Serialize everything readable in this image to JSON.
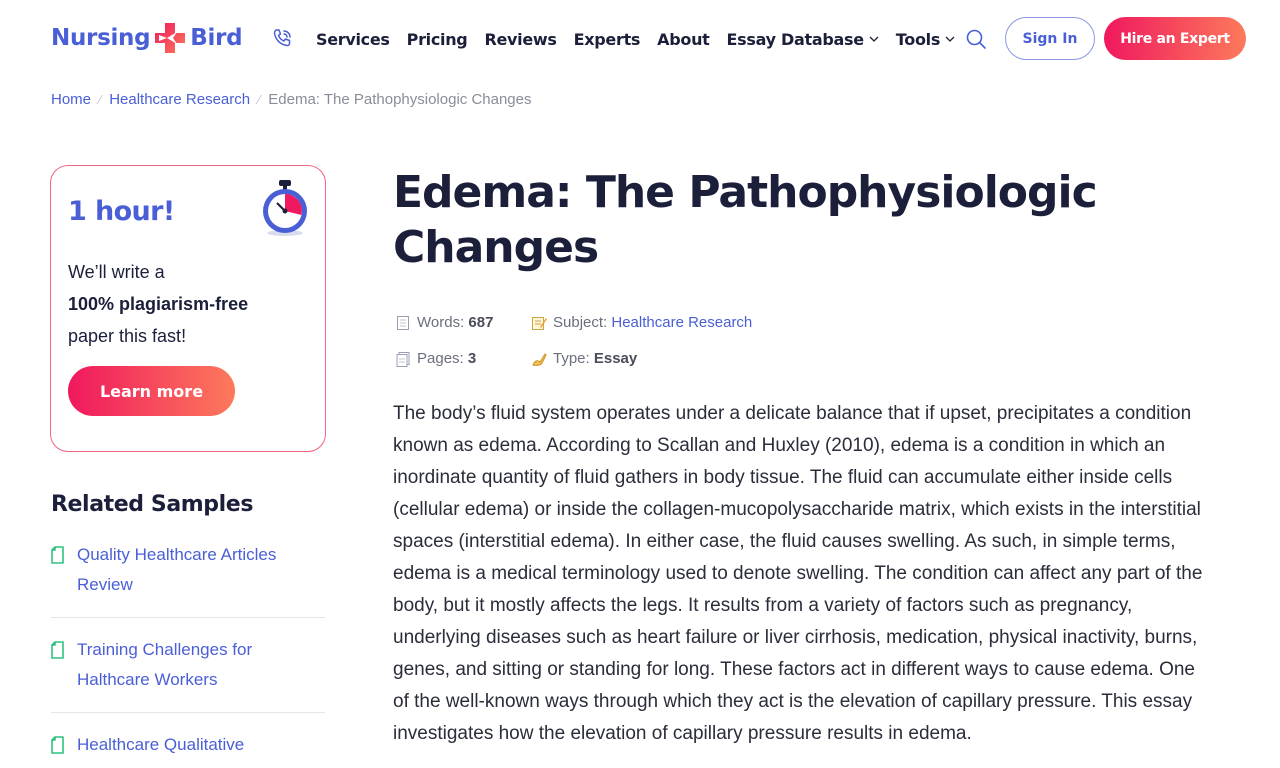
{
  "header": {
    "logo_left": "Nursing",
    "logo_right": "Bird",
    "nav": [
      {
        "label": "Services"
      },
      {
        "label": "Pricing"
      },
      {
        "label": "Reviews"
      },
      {
        "label": "Experts"
      },
      {
        "label": "About"
      },
      {
        "label": "Essay Database",
        "dropdown": true
      },
      {
        "label": "Tools",
        "dropdown": true
      }
    ],
    "signin_label": "Sign In",
    "hire_label": "Hire an Expert"
  },
  "breadcrumb": {
    "home": "Home",
    "category": "Healthcare Research",
    "current": "Edema: The Pathophysiologic Changes"
  },
  "promo": {
    "title": "1 hour!",
    "line1": "We’ll write a",
    "line2": "100% plagiarism-free",
    "line3": "paper this fast!",
    "button": "Learn more"
  },
  "related": {
    "title": "Related Samples",
    "items": [
      {
        "label": "Quality Healthcare Articles Review"
      },
      {
        "label": "Training Challenges for Halthcare Workers"
      },
      {
        "label": "Healthcare Qualitative"
      }
    ]
  },
  "article": {
    "title": "Edema: The Pathophysiologic Changes",
    "meta": {
      "words_label": "Words:",
      "words_value": "687",
      "subject_label": "Subject:",
      "subject_value": "Healthcare Research",
      "pages_label": "Pages:",
      "pages_value": "3",
      "type_label": "Type:",
      "type_value": "Essay"
    },
    "body": "The body’s fluid system operates under a delicate balance that if upset, precipitates a condition known as edema. According to Scallan and Huxley (2010), edema is a condition in which an inordinate quantity of fluid gathers in body tissue. The fluid can accumulate either inside cells (cellular edema) or inside the collagen-mucopolysaccharide matrix, which exists in the interstitial spaces (interstitial edema). In either case, the fluid causes swelling. As such, in simple terms, edema is a medical terminology used to denote swelling. The condition can affect any part of the body, but it mostly affects the legs. It results from a variety of factors such as pregnancy, underlying diseases such as heart failure or liver cirrhosis, medication, physical inactivity, burns, genes, and sitting or standing for long. These factors act in different ways to cause edema. One of the well-known ways through which they act is the elevation of capillary pressure. This essay investigates how the elevation of capillary pressure results in edema."
  },
  "colors": {
    "brand_blue": "#4a5fd6",
    "accent_pink": "#f0185e",
    "accent_orange": "#fd7a5b",
    "text_dark": "#1c1f3a"
  }
}
